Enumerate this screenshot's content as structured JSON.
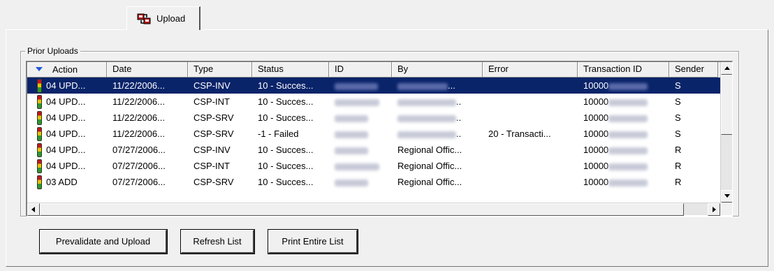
{
  "tab": {
    "label": "Upload",
    "icon": "upload-icon"
  },
  "group": {
    "label": "Prior Uploads"
  },
  "table": {
    "columns": [
      "Action",
      "Date",
      "Type",
      "Status",
      "ID",
      "By",
      "Error",
      "Transaction ID",
      "Sender"
    ],
    "sort_icon": "sort-desc-icon",
    "rows": [
      {
        "action": "04 UPD...",
        "date": "11/22/2006...",
        "type": "CSP-INV",
        "status": "10 - Succes...",
        "by": "...",
        "error": "",
        "txn": "10000",
        "sender": "S",
        "selected": true
      },
      {
        "action": "04 UPD...",
        "date": "11/22/2006...",
        "type": "CSP-INT",
        "status": "10 - Succes...",
        "by": "..",
        "error": "",
        "txn": "10000",
        "sender": "S",
        "selected": false
      },
      {
        "action": "04 UPD...",
        "date": "11/22/2006...",
        "type": "CSP-SRV",
        "status": "10 - Succes...",
        "by": "..",
        "error": "",
        "txn": "10000",
        "sender": "S",
        "selected": false
      },
      {
        "action": "04 UPD...",
        "date": "11/22/2006...",
        "type": "CSP-SRV",
        "status": "-1 - Failed",
        "by": "..",
        "error": "20   - Transacti...",
        "txn": "10000",
        "sender": "S",
        "selected": false
      },
      {
        "action": "04 UPD...",
        "date": "07/27/2006...",
        "type": "CSP-INV",
        "status": "10 - Succes...",
        "by": "Regional Offic...",
        "error": "",
        "txn": "10000",
        "sender": "R",
        "selected": false
      },
      {
        "action": "04 UPD...",
        "date": "07/27/2006...",
        "type": "CSP-INT",
        "status": "10 - Succes...",
        "by": "Regional Offic...",
        "error": "",
        "txn": "10000",
        "sender": "R",
        "selected": false
      },
      {
        "action": "03 ADD",
        "date": "07/27/2006...",
        "type": "CSP-SRV",
        "status": "10 - Succes...",
        "by": "Regional Offic...",
        "error": "",
        "txn": "10000",
        "sender": "R",
        "selected": false
      }
    ]
  },
  "buttons": {
    "prevalidate": "Prevalidate and Upload",
    "refresh": "Refresh List",
    "print": "Print Entire List"
  }
}
